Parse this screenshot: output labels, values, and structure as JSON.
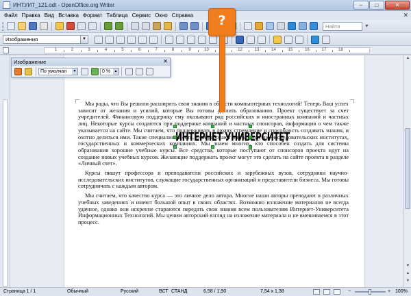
{
  "window": {
    "title": "ИНТУИТ_121.odt - OpenOffice.org Writer",
    "minimize": "–",
    "maximize": "□",
    "close": "✕"
  },
  "menu": {
    "items": [
      "Файл",
      "Правка",
      "Вид",
      "Вставка",
      "Формат",
      "Таблица",
      "Сервис",
      "Окно",
      "Справка"
    ],
    "doc_close": "✕"
  },
  "toolbar": {
    "find_placeholder": "Найти",
    "paragraph_style": "Изображения"
  },
  "ruler": {
    "numbers": [
      "1",
      "2",
      "3",
      "4",
      "5",
      "6",
      "7",
      "8",
      "9",
      "10",
      "11",
      "12",
      "13",
      "14",
      "15",
      "16",
      "17",
      "18"
    ]
  },
  "image_toolbar": {
    "title": "Изображение",
    "close": "✕",
    "mode": "По умолчан",
    "transparency": "0 %"
  },
  "document": {
    "paragraphs": [
      "Мы рады, что Вы решили расширить свои знания в области компьютерных технологий! Теперь Ваш успех зависит от желания и усилий, которые Вы готовы уделить образованию. Проект существует за счет учредителей. Финансовую поддержку ему оказывают ряд российских и иностранных компаний и частных лиц. Некоторые курсы создаются при поддержке компаний и частных спонсоров, информация о чем также указывается на сайте. Мы считаем, что поддерживать в людях стремление и способность создавать знания, и охотно делиться ими. Такие специалисты есть. Они работают в вузах, научно-исследовательских институтах, государственных и коммерческих компаниях. Мы знаем многих, кто способен создать для системы образования хорошие учебные курсы. Все средства, которые поступают от спонсоров проекта идут на создание новых учебных курсов. Желающие поддержать проект могут это сделать на сайте проекта в разделе «Личный счет».",
      "Курсы пишут профессора и преподаватели российских и зарубежных вузов, сотрудники научно-исследовательских институтов, служащие государственных организаций и представители бизнеса. Мы готовы сотрудничать с каждым автором.",
      "Мы считаем, что качество курса — это личное дело автора. Многие наши авторы преподают в различных учебных заведениях и имеют большой опыт в своих областях. Возможно изложение материалов не всегда удачное, однако они искренне стараются передать свои знания всем пользователям Интернет-Университета Информационных Технологий. Мы ценим авторский взгляд на изложение материала и не вмешиваемся в этот процесс."
    ],
    "logo_text": "ИНТЕРНЕТ УНИВЕРСИТЕТ"
  },
  "callout": {
    "symbol": "?"
  },
  "status": {
    "page": "Страница 1 / 1",
    "style": "Обычный",
    "language": "Русский",
    "insert_mode": "ВСТ",
    "selection_mode": "СТАНД",
    "position": "6,58 / 1,90",
    "size": "7,54 x 1,38",
    "zoom": "100%"
  },
  "colors": {
    "callout": "#f07d1e",
    "selection_handles": "#3fb84a"
  }
}
